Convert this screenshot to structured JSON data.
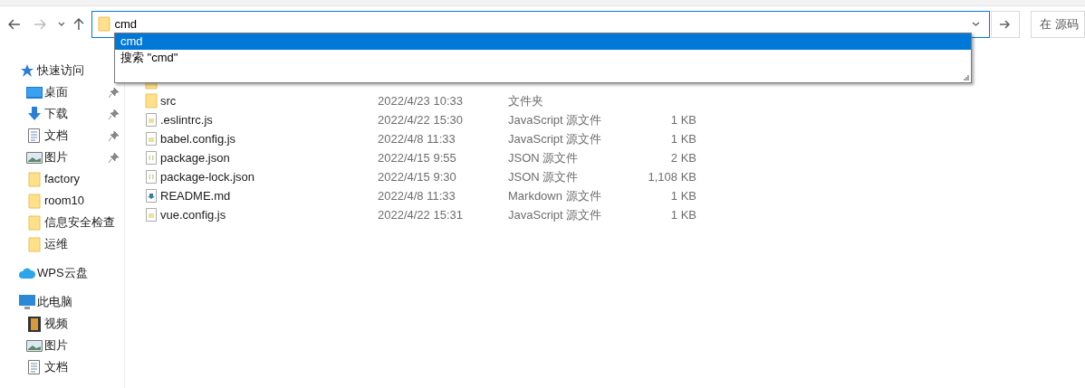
{
  "address_bar": {
    "value": "cmd",
    "suggestions": [
      {
        "text": "cmd",
        "selected": true
      },
      {
        "text": "搜索 \"cmd\"",
        "selected": false
      }
    ]
  },
  "search": {
    "placeholder": "在 源码"
  },
  "sidebar": {
    "groups": [
      {
        "label": "快速访问",
        "kind": "star",
        "children": [
          {
            "label": "桌面",
            "kind": "desktop",
            "pinned": true
          },
          {
            "label": "下载",
            "kind": "download",
            "pinned": true
          },
          {
            "label": "文档",
            "kind": "document",
            "pinned": true
          },
          {
            "label": "图片",
            "kind": "pictures",
            "pinned": true
          },
          {
            "label": "factory",
            "kind": "folder",
            "pinned": false
          },
          {
            "label": "room10",
            "kind": "folder",
            "pinned": false
          },
          {
            "label": "信息安全检查",
            "kind": "folder",
            "pinned": false
          },
          {
            "label": "运维",
            "kind": "folder",
            "pinned": false
          }
        ]
      },
      {
        "label": "WPS云盘",
        "kind": "cloud"
      },
      {
        "label": "此电脑",
        "kind": "computer",
        "children": [
          {
            "label": "视频",
            "kind": "video",
            "pinned": false
          },
          {
            "label": "图片",
            "kind": "pictures",
            "pinned": false
          },
          {
            "label": "文档",
            "kind": "document",
            "pinned": false
          }
        ]
      }
    ]
  },
  "files": [
    {
      "kind": "folder"
    },
    {
      "name": "src",
      "date": "2022/4/23 10:33",
      "type": "文件夹",
      "kind": "folder"
    },
    {
      "name": ".eslintrc.js",
      "date": "2022/4/22 15:30",
      "type": "JavaScript 源文件",
      "size": "1 KB",
      "kind": "js"
    },
    {
      "name": "babel.config.js",
      "date": "2022/4/8 11:33",
      "type": "JavaScript 源文件",
      "size": "1 KB",
      "kind": "js"
    },
    {
      "name": "package.json",
      "date": "2022/4/15 9:55",
      "type": "JSON 源文件",
      "size": "2 KB",
      "kind": "json"
    },
    {
      "name": "package-lock.json",
      "date": "2022/4/15 9:30",
      "type": "JSON 源文件",
      "size": "1,108 KB",
      "kind": "json"
    },
    {
      "name": "README.md",
      "date": "2022/4/8 11:33",
      "type": "Markdown 源文件",
      "size": "1 KB",
      "kind": "md"
    },
    {
      "name": "vue.config.js",
      "date": "2022/4/22 15:31",
      "type": "JavaScript 源文件",
      "size": "1 KB",
      "kind": "js"
    }
  ]
}
